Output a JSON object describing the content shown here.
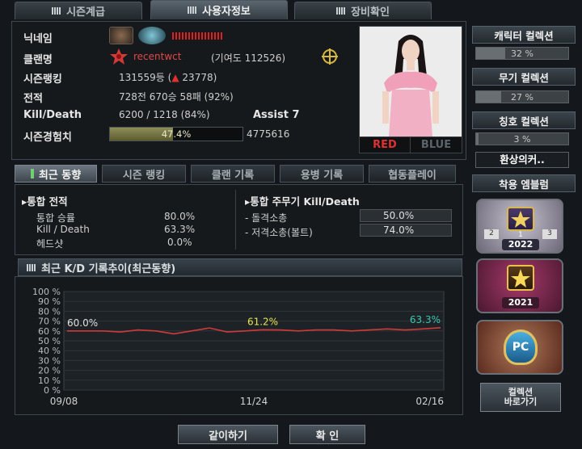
{
  "top_tabs": [
    {
      "label": "시즌계급"
    },
    {
      "label": "사용자정보"
    },
    {
      "label": "장비확인"
    }
  ],
  "profile": {
    "nickname_label": "닉네임",
    "clan_label": "클랜명",
    "clan_name": "recentwct",
    "clan_contribution": "(기여도 112526)",
    "season_rank_label": "시즌랭킹",
    "season_rank_value": "131559등 (",
    "season_rank_change": "▲",
    "season_rank_change_value": "23778",
    "season_rank_close": ")",
    "record_label": "전적",
    "record_value": "728전 670승 58패 (92%)",
    "kd_label": "Kill/Death",
    "kd_value": "6200 / 1218 (84%)",
    "assist_label": "Assist 7",
    "exp_label": "시즌경험치",
    "exp_percent_text": "47.4%",
    "exp_fraction": 0.474,
    "exp_value": "4775616",
    "team_red": "RED",
    "team_blue": "BLUE"
  },
  "sub_tabs": [
    {
      "label": "최근 동향"
    },
    {
      "label": "시즌 랭킹"
    },
    {
      "label": "클랜 기록"
    },
    {
      "label": "용병 기록"
    },
    {
      "label": "협동플레이"
    }
  ],
  "stats": {
    "left_header": "통합 전적",
    "left_rows": [
      {
        "label": "통합 승률",
        "value": "80.0%"
      },
      {
        "label": "Kill / Death",
        "value": "63.3%"
      },
      {
        "label": "헤드샷",
        "value": "0.0%"
      }
    ],
    "right_header": "통합 주무기 Kill/Death",
    "right_rows": [
      {
        "label": "- 돌격소총",
        "value": "50.0%"
      },
      {
        "label": "- 저격소총(볼트)",
        "value": "74.0%"
      }
    ]
  },
  "chart_section_title": "최근 K/D 기록추이(최근동향)",
  "chart_data": {
    "type": "line",
    "x": [
      "09/08",
      "11/24",
      "02/16"
    ],
    "ylim": [
      0,
      100
    ],
    "y_ticks": [
      "100 %",
      "90 %",
      "80 %",
      "70 %",
      "60 %",
      "50 %",
      "40 %",
      "30 %",
      "20 %",
      "10 %",
      "0 %"
    ],
    "series": [
      {
        "values": [
          60.0,
          60,
          60,
          59,
          61,
          60,
          57,
          60,
          63,
          59,
          60,
          61.2,
          61,
          60,
          61,
          61,
          60,
          61,
          62,
          61,
          62,
          63.3
        ],
        "color": "#d23a3a"
      }
    ],
    "annotations": [
      {
        "text": "60.0%",
        "color": "#e0e0e0"
      },
      {
        "text": "61.2%",
        "color": "#e6e64a"
      },
      {
        "text": "63.3%",
        "color": "#3ec7b0"
      }
    ],
    "x_tick_labels": [
      "09/08",
      "11/24",
      "02/16"
    ]
  },
  "sidebar": {
    "character_collection_label": "캐릭터 컬렉션",
    "character_collection_value": "32 %",
    "character_collection_fraction": 0.32,
    "weapon_collection_label": "무기 컬렉션",
    "weapon_collection_value": "27 %",
    "weapon_collection_fraction": 0.27,
    "title_collection_label": "칭호 컬렉션",
    "title_collection_value": "3 %",
    "title_collection_fraction": 0.03,
    "title_name": "환상의커..",
    "emblem_label": "착용 엠블럼",
    "emblems": [
      {
        "year": "2022",
        "rank_left": "2",
        "rank_mid": "1",
        "rank_right": "3"
      },
      {
        "year": "2021"
      },
      {
        "text": "PC"
      }
    ],
    "collection_shortcut": "컬렉션\n바로가기"
  },
  "buttons": {
    "compare": "같이하기",
    "confirm": "확 인"
  }
}
